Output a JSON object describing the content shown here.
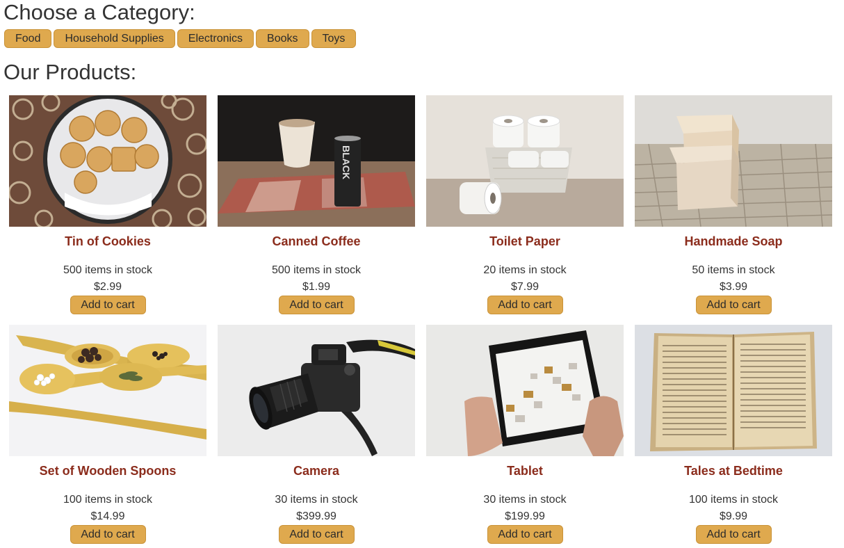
{
  "category_heading": "Choose a Category:",
  "categories": [
    "Food",
    "Household Supplies",
    "Electronics",
    "Books",
    "Toys"
  ],
  "products_heading": "Our Products:",
  "accent_color": "#dfa94e",
  "product_name_color": "#8b2c1c",
  "products": [
    {
      "name": "Tin of Cookies",
      "stock": "500 items in stock",
      "price": "$2.99",
      "cart_label": "Add to cart",
      "image": "cookie-tin-photo"
    },
    {
      "name": "Canned Coffee",
      "stock": "500 items in stock",
      "price": "$1.99",
      "cart_label": "Add to cart",
      "image": "coffee-can-photo",
      "image_text": "BLACK"
    },
    {
      "name": "Toilet Paper",
      "stock": "20 items in stock",
      "price": "$7.99",
      "cart_label": "Add to cart",
      "image": "toilet-paper-photo"
    },
    {
      "name": "Handmade Soap",
      "stock": "50 items in stock",
      "price": "$3.99",
      "cart_label": "Add to cart",
      "image": "soap-photo"
    },
    {
      "name": "Set of Wooden Spoons",
      "stock": "100 items in stock",
      "price": "$14.99",
      "cart_label": "Add to cart",
      "image": "wooden-spoons-photo"
    },
    {
      "name": "Camera",
      "stock": "30 items in stock",
      "price": "$399.99",
      "cart_label": "Add to cart",
      "image": "camera-photo"
    },
    {
      "name": "Tablet",
      "stock": "30 items in stock",
      "price": "$199.99",
      "cart_label": "Add to cart",
      "image": "tablet-photo"
    },
    {
      "name": "Tales at Bedtime",
      "stock": "100 items in stock",
      "price": "$9.99",
      "cart_label": "Add to cart",
      "image": "open-book-photo"
    }
  ]
}
